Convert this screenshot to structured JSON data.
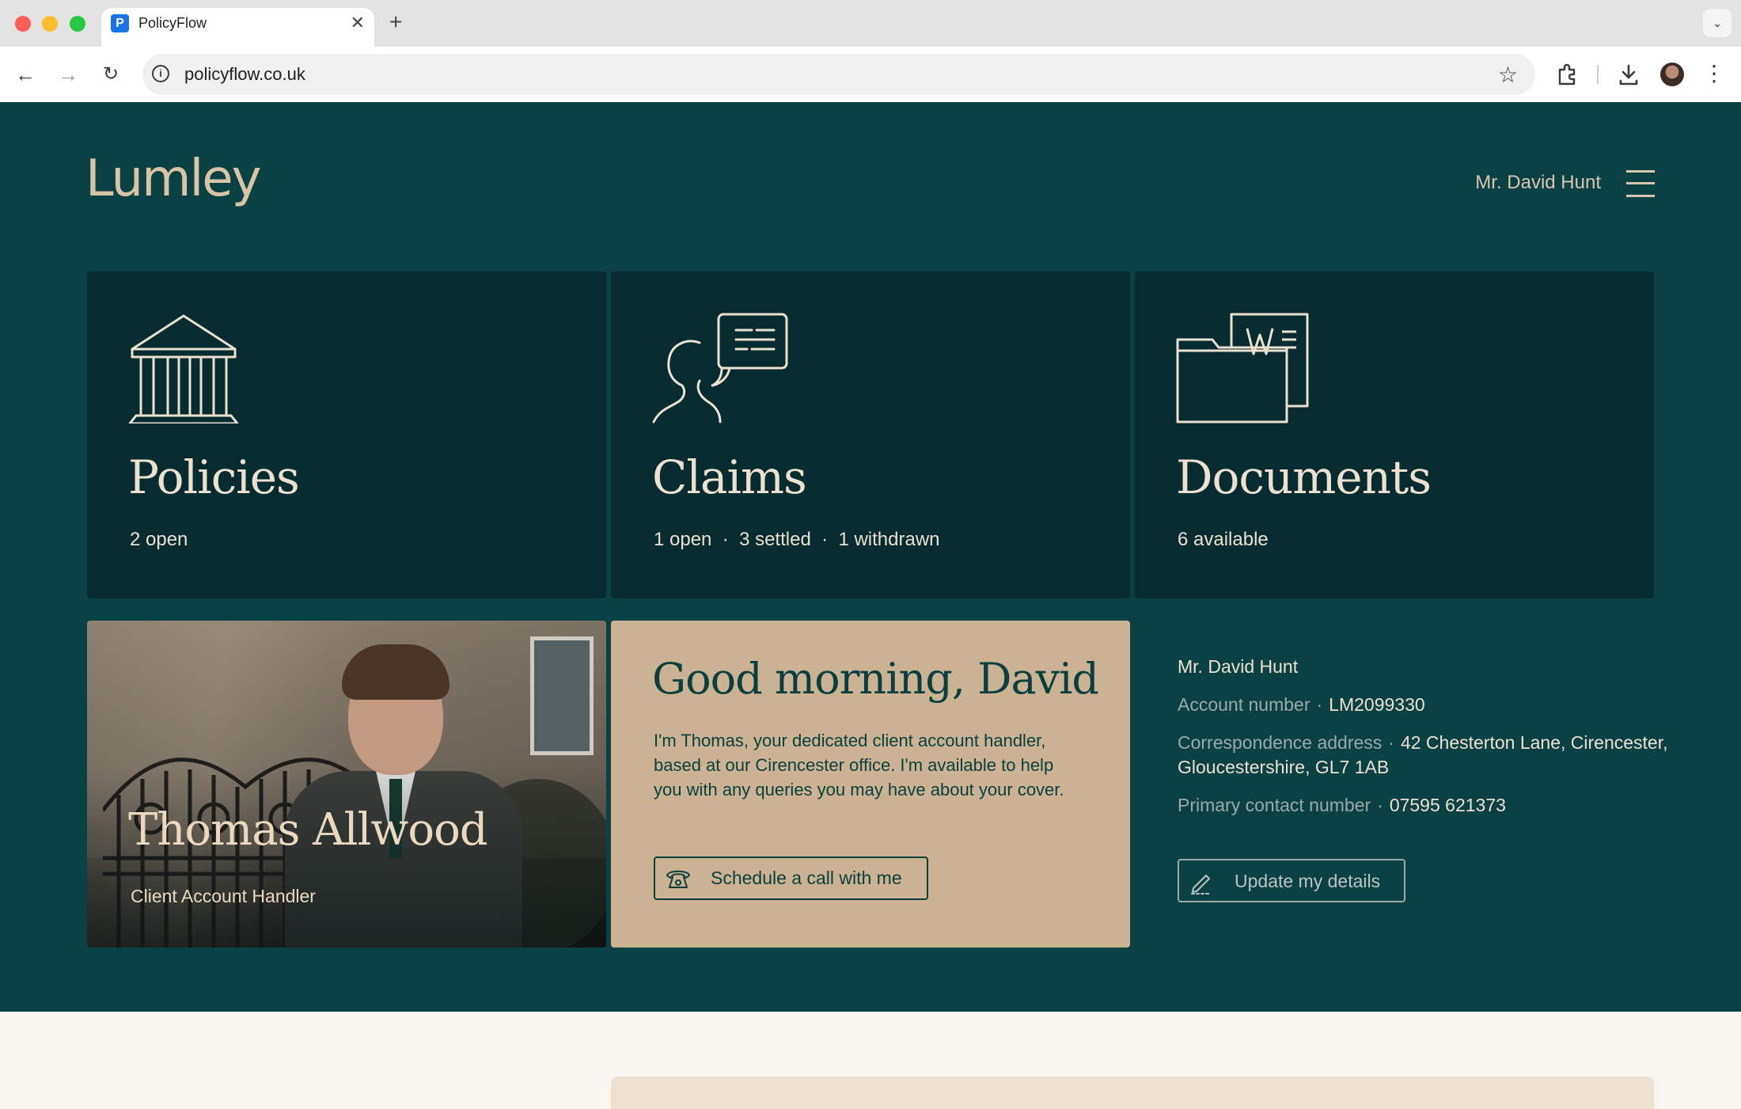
{
  "browser": {
    "tab_title": "PolicyFlow",
    "favicon_letter": "P",
    "url": "policyflow.co.uk",
    "new_tab_symbol": "+",
    "close_symbol": "✕"
  },
  "header": {
    "logo_text": "Lumley",
    "user_name": "Mr. David Hunt"
  },
  "tiles": [
    {
      "title": "Policies",
      "subtitle": "2 open",
      "icon": "bank-building-icon"
    },
    {
      "title": "Claims",
      "subtitle": "1 open  ·  3 settled  ·  1 withdrawn",
      "icon": "chat-person-icon"
    },
    {
      "title": "Documents",
      "subtitle": "6 available",
      "icon": "word-folder-icon"
    }
  ],
  "handler": {
    "name": "Thomas Allwood",
    "role": "Client Account Handler"
  },
  "greeting": {
    "title": "Good morning, David",
    "body": "I'm Thomas, your dedicated client account handler, based at our Cirencester office. I'm available to help you with any queries you may have about your cover.",
    "button_label": "Schedule a call with me"
  },
  "account": {
    "name": "Mr. David Hunt",
    "account_number_label": "Account number",
    "account_number": "LM2099330",
    "address_label": "Correspondence address",
    "address": "42 Chesterton Lane, Cirencester, Gloucestershire, GL7 1AB",
    "phone_label": "Primary contact number",
    "phone": "07595 621373",
    "update_label": "Update my details"
  },
  "colors": {
    "hero_bg": "#0a4244",
    "tile_bg": "#062c2f",
    "greet_bg": "#cbb292",
    "accent_text": "#ece1d0"
  }
}
